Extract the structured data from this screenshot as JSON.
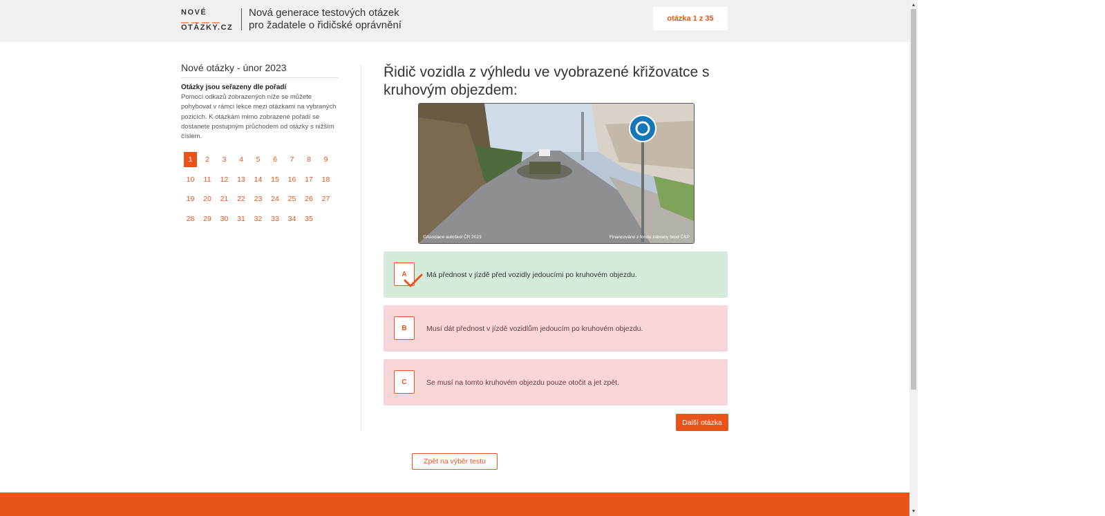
{
  "header": {
    "logo_line1": "NOVÉ",
    "logo_line2": "OTÁZKY.CZ",
    "tagline_line1": "Nová generace testových otázek",
    "tagline_line2": "pro žadatele o řidičské oprávnění",
    "counter": "otázka 1 z 35"
  },
  "sidebar": {
    "title": "Nové otázky - únor 2023",
    "subtitle": "Otázky jsou seřazeny dle pořadí",
    "description": "Pomocí odkazů zobrazených níže se můžete pohybovat v rámci lekce mezi otázkami na vybraných pozicích. K otázkám mimo zobrazené pořadí se dostanete postupným průchodem od otázky s nižším číslem.",
    "active_question": 1,
    "questions": [
      "1",
      "2",
      "3",
      "4",
      "5",
      "6",
      "7",
      "8",
      "9",
      "10",
      "11",
      "12",
      "13",
      "14",
      "15",
      "16",
      "17",
      "18",
      "19",
      "20",
      "21",
      "22",
      "23",
      "24",
      "25",
      "26",
      "27",
      "28",
      "29",
      "30",
      "31",
      "32",
      "33",
      "34",
      "35"
    ]
  },
  "question": {
    "text": "Řidič vozidla z výhledu ve vyobrazené křižovatce s kruhovým objezdem:",
    "image_caption_left": "©Asociace autoškol ČR 2023",
    "image_caption_right": "Financováno z fondu zábrany škod ČKP"
  },
  "answers": [
    {
      "letter": "A",
      "text": "Má přednost v jízdě před vozidly jedoucími po kruhovém objezdu.",
      "state": "correct",
      "color": "#d4ebdb"
    },
    {
      "letter": "B",
      "text": "Musí dát přednost v jízdě vozidlům jedoucím po kruhovém objezdu.",
      "state": "wrong",
      "color": "#f7d6da"
    },
    {
      "letter": "C",
      "text": "Se musí na tomto kruhovém objezdu pouze otočit a jet zpět.",
      "state": "wrong",
      "color": "#f7d6da"
    }
  ],
  "buttons": {
    "next": "Další otázka",
    "back": "Zpět na výběr testu"
  },
  "colors": {
    "accent": "#e8541b",
    "correct_bg": "#d4ebdb",
    "wrong_bg": "#f7d6da"
  }
}
